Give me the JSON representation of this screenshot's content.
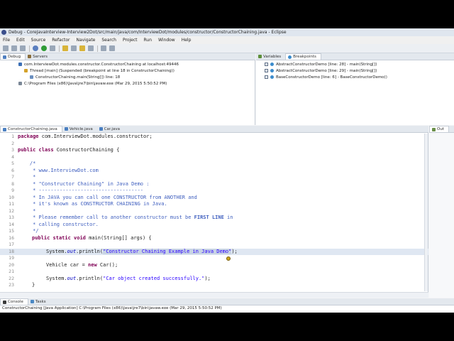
{
  "window": {
    "title": "Debug - CoreJavaInterview-Interview2Dot/src/main/java/com/InterviewDot/modules/constructor/ConstructorChaining.java - Eclipse"
  },
  "menu": [
    "File",
    "Edit",
    "Source",
    "Refactor",
    "Navigate",
    "Search",
    "Project",
    "Run",
    "Window",
    "Help"
  ],
  "debug_panel": {
    "tabs": [
      "Debug",
      "Servers"
    ],
    "tree": [
      "com.InterviewDot.modules.constructor.ConstructorChaining at localhost:49446",
      "Thread [main] (Suspended (breakpoint at line 18 in ConstructorChaining))",
      "ConstructorChaining.main(String[]) line: 18",
      "C:\\Program Files (x86)\\Java\\jre7\\bin\\javaw.exe (Mar 29, 2015 5:50:52 PM)"
    ]
  },
  "vars_panel": {
    "tabs": [
      "Variables",
      "Breakpoints"
    ],
    "breakpoints": [
      "AbstractConstructorDemo [line: 28] - main(String[])",
      "AbstractConstructorDemo [line: 29] - main(String[])",
      "BaseConstructorDemo [line: 6] - BaseConstructorDemo()"
    ]
  },
  "editor": {
    "tabs": [
      "ConstructorChaining.java",
      "Vehicle.java",
      "Car.java"
    ],
    "line_numbers": [
      "1",
      "2",
      "3",
      "4",
      "5",
      "6",
      "7",
      "8",
      "9",
      "10",
      "11",
      "12",
      "13",
      "14",
      "15",
      "16",
      "17",
      "18",
      "19",
      "20",
      "21",
      "22",
      "23"
    ],
    "code": {
      "l1_kw": "package",
      "l1_rest": " com.InterviewDot.modules.constructor;",
      "l3_kw1": "public",
      "l3_kw2": "class",
      "l3_rest": " ConstructorChaining {",
      "l5": "    /*",
      "l6": "     * www.InterviewDot.com",
      "l7": "     *",
      "l8": "     * \"Constructor Chaining\" in Java Demo :",
      "l9": "     * -----------------------------------",
      "l10": "     * In JAVA you can call one CONSTRUCTOR from ANOTHER and",
      "l11": "     * it's known as CONSTRUCTOR CHAINING in Java.",
      "l12": "     *",
      "l13a": "     * Please remember call to another constructor must be ",
      "l13b": "FIRST LINE",
      "l13c": " in",
      "l14": "     * calling constructor.",
      "l15": "     */",
      "l16_kw1": "public",
      "l16_kw2": "static",
      "l16_kw3": "void",
      "l16_rest": " main(String[] args) {",
      "l18_a": "System.",
      "l18_fld": "out",
      "l18_b": ".println(",
      "l18_str": "\"Constructor Chaining Example in Java Demo\"",
      "l18_c": ");",
      "l20_a": "Vehicle car = ",
      "l20_kw": "new",
      "l20_b": " Car();",
      "l22_a": "System.",
      "l22_fld": "out",
      "l22_b": ".println(",
      "l22_str": "\"Car object created successfully.\"",
      "l22_c": ");",
      "l23": "}"
    }
  },
  "outline": {
    "tab": "Out"
  },
  "console": {
    "tabs": [
      "Console",
      "Tasks"
    ],
    "text": "ConstructorChaining [Java Application] C:\\Program Files (x86)\\Java\\jre7\\bin\\javaw.exe (Mar 29, 2015 5:50:52 PM)"
  },
  "colors": {
    "keyword": "#7f0055",
    "comment": "#3f5fbf",
    "string": "#2a00ff",
    "current_line": "#dfe7f2"
  }
}
